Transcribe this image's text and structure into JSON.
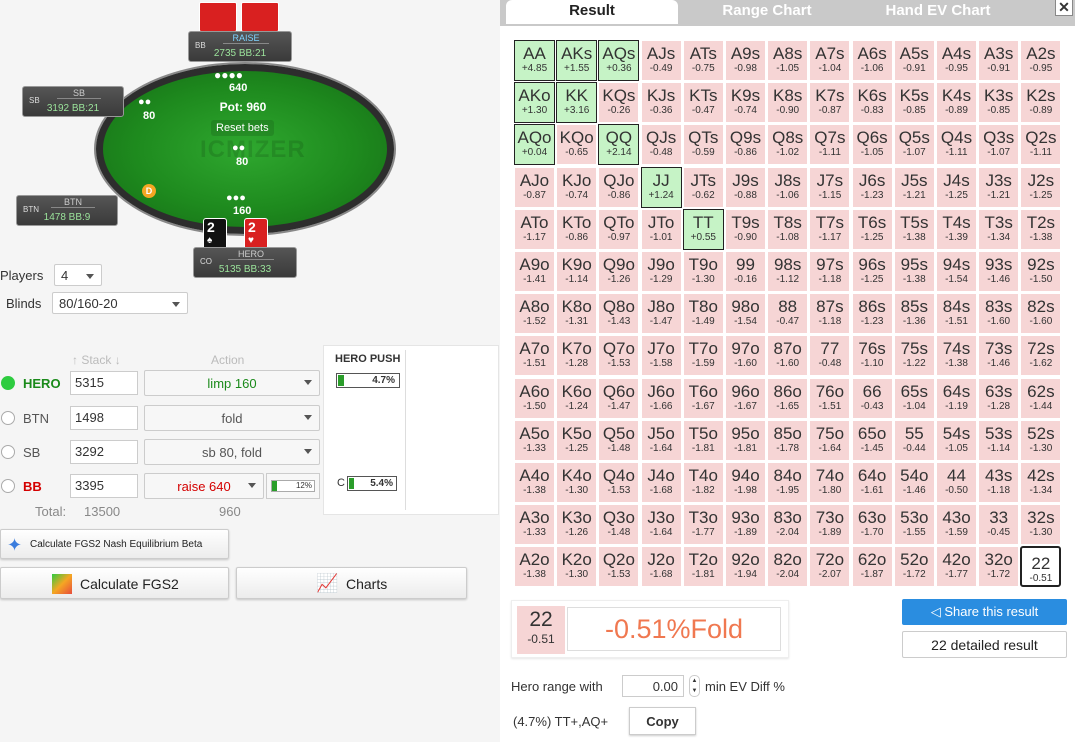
{
  "table": {
    "watermark": "ICMIZER",
    "pot_label": "Pot: 960",
    "reset_label": "Reset bets",
    "dealer": "D",
    "bets": {
      "top": "640",
      "sb": "80",
      "center": "80",
      "hero": "160"
    },
    "seats": {
      "bb": {
        "pos": "BB",
        "name": "RAISE",
        "stack": "2735 BB:21"
      },
      "sb": {
        "pos": "SB",
        "name": "SB",
        "stack": "3192 BB:21"
      },
      "btn": {
        "pos": "BTN",
        "name": "BTN",
        "stack": "1478 BB:9"
      },
      "hero": {
        "pos": "CO",
        "name": "HERO",
        "stack": "5135 BB:33"
      }
    },
    "hero_cards": [
      {
        "rank": "2",
        "suit": "spade"
      },
      {
        "rank": "2",
        "suit": "heart"
      }
    ]
  },
  "settings": {
    "players_label": "Players",
    "players_value": "4",
    "blinds_label": "Blinds",
    "blinds_value": "80/160-20"
  },
  "players_table": {
    "stack_header": "Stack",
    "action_header": "Action",
    "rows": [
      {
        "name": "HERO",
        "stack": "5315",
        "action": "limp 160",
        "color": "#1a8a1a",
        "selected": true
      },
      {
        "name": "BTN",
        "stack": "1498",
        "action": "fold",
        "color": "#555555",
        "selected": false
      },
      {
        "name": "SB",
        "stack": "3292",
        "action": "sb 80, fold",
        "color": "#555555",
        "selected": false
      },
      {
        "name": "BB",
        "stack": "3395",
        "action": "raise 640",
        "color": "#d40000",
        "selected": false,
        "bb_pct": "12%"
      }
    ],
    "total_label": "Total:",
    "total_stack": "13500",
    "total_pot": "960"
  },
  "hero_push": {
    "title": "HERO PUSH",
    "push_pct": "4.7%",
    "push_fill": 0.047,
    "call_label": "C",
    "call_pct": "5.4%",
    "call_fill": 0.054
  },
  "buttons": {
    "nash": "Calculate FGS2 Nash Equilibrium  Beta",
    "calc": "Calculate FGS2",
    "charts": "Charts",
    "share": "Share this result",
    "detail": "22 detailed result",
    "copy": "Copy"
  },
  "tabs": [
    "Result",
    "Range Chart",
    "Hand EV Chart"
  ],
  "grid": [
    [
      [
        "AA",
        "+4.85",
        1
      ],
      [
        "AKs",
        "+1.55",
        1
      ],
      [
        "AQs",
        "+0.36",
        1
      ],
      [
        "AJs",
        "-0.49",
        0
      ],
      [
        "ATs",
        "-0.75",
        0
      ],
      [
        "A9s",
        "-0.98",
        0
      ],
      [
        "A8s",
        "-1.05",
        0
      ],
      [
        "A7s",
        "-1.04",
        0
      ],
      [
        "A6s",
        "-1.06",
        0
      ],
      [
        "A5s",
        "-0.91",
        0
      ],
      [
        "A4s",
        "-0.95",
        0
      ],
      [
        "A3s",
        "-0.91",
        0
      ],
      [
        "A2s",
        "-0.95",
        0
      ]
    ],
    [
      [
        "AKo",
        "+1.30",
        1
      ],
      [
        "KK",
        "+3.16",
        1
      ],
      [
        "KQs",
        "-0.26",
        0
      ],
      [
        "KJs",
        "-0.36",
        0
      ],
      [
        "KTs",
        "-0.47",
        0
      ],
      [
        "K9s",
        "-0.74",
        0
      ],
      [
        "K8s",
        "-0.90",
        0
      ],
      [
        "K7s",
        "-0.87",
        0
      ],
      [
        "K6s",
        "-0.83",
        0
      ],
      [
        "K5s",
        "-0.85",
        0
      ],
      [
        "K4s",
        "-0.89",
        0
      ],
      [
        "K3s",
        "-0.85",
        0
      ],
      [
        "K2s",
        "-0.89",
        0
      ]
    ],
    [
      [
        "AQo",
        "+0.04",
        1
      ],
      [
        "KQo",
        "-0.65",
        0
      ],
      [
        "QQ",
        "+2.14",
        1
      ],
      [
        "QJs",
        "-0.48",
        0
      ],
      [
        "QTs",
        "-0.59",
        0
      ],
      [
        "Q9s",
        "-0.86",
        0
      ],
      [
        "Q8s",
        "-1.02",
        0
      ],
      [
        "Q7s",
        "-1.11",
        0
      ],
      [
        "Q6s",
        "-1.05",
        0
      ],
      [
        "Q5s",
        "-1.07",
        0
      ],
      [
        "Q4s",
        "-1.11",
        0
      ],
      [
        "Q3s",
        "-1.07",
        0
      ],
      [
        "Q2s",
        "-1.11",
        0
      ]
    ],
    [
      [
        "AJo",
        "-0.87",
        0
      ],
      [
        "KJo",
        "-0.74",
        0
      ],
      [
        "QJo",
        "-0.86",
        0
      ],
      [
        "JJ",
        "+1.24",
        1
      ],
      [
        "JTs",
        "-0.62",
        0
      ],
      [
        "J9s",
        "-0.88",
        0
      ],
      [
        "J8s",
        "-1.06",
        0
      ],
      [
        "J7s",
        "-1.15",
        0
      ],
      [
        "J6s",
        "-1.23",
        0
      ],
      [
        "J5s",
        "-1.21",
        0
      ],
      [
        "J4s",
        "-1.25",
        0
      ],
      [
        "J3s",
        "-1.21",
        0
      ],
      [
        "J2s",
        "-1.25",
        0
      ]
    ],
    [
      [
        "ATo",
        "-1.17",
        0
      ],
      [
        "KTo",
        "-0.86",
        0
      ],
      [
        "QTo",
        "-0.97",
        0
      ],
      [
        "JTo",
        "-1.01",
        0
      ],
      [
        "TT",
        "+0.55",
        1
      ],
      [
        "T9s",
        "-0.90",
        0
      ],
      [
        "T8s",
        "-1.08",
        0
      ],
      [
        "T7s",
        "-1.17",
        0
      ],
      [
        "T6s",
        "-1.25",
        0
      ],
      [
        "T5s",
        "-1.38",
        0
      ],
      [
        "T4s",
        "-1.39",
        0
      ],
      [
        "T3s",
        "-1.34",
        0
      ],
      [
        "T2s",
        "-1.38",
        0
      ]
    ],
    [
      [
        "A9o",
        "-1.41",
        0
      ],
      [
        "K9o",
        "-1.14",
        0
      ],
      [
        "Q9o",
        "-1.26",
        0
      ],
      [
        "J9o",
        "-1.29",
        0
      ],
      [
        "T9o",
        "-1.30",
        0
      ],
      [
        "99",
        "-0.16",
        0
      ],
      [
        "98s",
        "-1.12",
        0
      ],
      [
        "97s",
        "-1.18",
        0
      ],
      [
        "96s",
        "-1.25",
        0
      ],
      [
        "95s",
        "-1.38",
        0
      ],
      [
        "94s",
        "-1.54",
        0
      ],
      [
        "93s",
        "-1.46",
        0
      ],
      [
        "92s",
        "-1.50",
        0
      ]
    ],
    [
      [
        "A8o",
        "-1.52",
        0
      ],
      [
        "K8o",
        "-1.31",
        0
      ],
      [
        "Q8o",
        "-1.43",
        0
      ],
      [
        "J8o",
        "-1.47",
        0
      ],
      [
        "T8o",
        "-1.49",
        0
      ],
      [
        "98o",
        "-1.54",
        0
      ],
      [
        "88",
        "-0.47",
        0
      ],
      [
        "87s",
        "-1.18",
        0
      ],
      [
        "86s",
        "-1.23",
        0
      ],
      [
        "85s",
        "-1.36",
        0
      ],
      [
        "84s",
        "-1.51",
        0
      ],
      [
        "83s",
        "-1.60",
        0
      ],
      [
        "82s",
        "-1.60",
        0
      ]
    ],
    [
      [
        "A7o",
        "-1.51",
        0
      ],
      [
        "K7o",
        "-1.28",
        0
      ],
      [
        "Q7o",
        "-1.53",
        0
      ],
      [
        "J7o",
        "-1.58",
        0
      ],
      [
        "T7o",
        "-1.59",
        0
      ],
      [
        "97o",
        "-1.60",
        0
      ],
      [
        "87o",
        "-1.60",
        0
      ],
      [
        "77",
        "-0.48",
        0
      ],
      [
        "76s",
        "-1.10",
        0
      ],
      [
        "75s",
        "-1.22",
        0
      ],
      [
        "74s",
        "-1.38",
        0
      ],
      [
        "73s",
        "-1.46",
        0
      ],
      [
        "72s",
        "-1.62",
        0
      ]
    ],
    [
      [
        "A6o",
        "-1.50",
        0
      ],
      [
        "K6o",
        "-1.24",
        0
      ],
      [
        "Q6o",
        "-1.47",
        0
      ],
      [
        "J6o",
        "-1.66",
        0
      ],
      [
        "T6o",
        "-1.67",
        0
      ],
      [
        "96o",
        "-1.67",
        0
      ],
      [
        "86o",
        "-1.65",
        0
      ],
      [
        "76o",
        "-1.51",
        0
      ],
      [
        "66",
        "-0.43",
        0
      ],
      [
        "65s",
        "-1.04",
        0
      ],
      [
        "64s",
        "-1.19",
        0
      ],
      [
        "63s",
        "-1.28",
        0
      ],
      [
        "62s",
        "-1.44",
        0
      ]
    ],
    [
      [
        "A5o",
        "-1.33",
        0
      ],
      [
        "K5o",
        "-1.25",
        0
      ],
      [
        "Q5o",
        "-1.48",
        0
      ],
      [
        "J5o",
        "-1.64",
        0
      ],
      [
        "T5o",
        "-1.81",
        0
      ],
      [
        "95o",
        "-1.81",
        0
      ],
      [
        "85o",
        "-1.78",
        0
      ],
      [
        "75o",
        "-1.64",
        0
      ],
      [
        "65o",
        "-1.45",
        0
      ],
      [
        "55",
        "-0.44",
        0
      ],
      [
        "54s",
        "-1.05",
        0
      ],
      [
        "53s",
        "-1.14",
        0
      ],
      [
        "52s",
        "-1.30",
        0
      ]
    ],
    [
      [
        "A4o",
        "-1.38",
        0
      ],
      [
        "K4o",
        "-1.30",
        0
      ],
      [
        "Q4o",
        "-1.53",
        0
      ],
      [
        "J4o",
        "-1.68",
        0
      ],
      [
        "T4o",
        "-1.82",
        0
      ],
      [
        "94o",
        "-1.98",
        0
      ],
      [
        "84o",
        "-1.95",
        0
      ],
      [
        "74o",
        "-1.80",
        0
      ],
      [
        "64o",
        "-1.61",
        0
      ],
      [
        "54o",
        "-1.46",
        0
      ],
      [
        "44",
        "-0.50",
        0
      ],
      [
        "43s",
        "-1.18",
        0
      ],
      [
        "42s",
        "-1.34",
        0
      ]
    ],
    [
      [
        "A3o",
        "-1.33",
        0
      ],
      [
        "K3o",
        "-1.26",
        0
      ],
      [
        "Q3o",
        "-1.48",
        0
      ],
      [
        "J3o",
        "-1.64",
        0
      ],
      [
        "T3o",
        "-1.77",
        0
      ],
      [
        "93o",
        "-1.89",
        0
      ],
      [
        "83o",
        "-2.04",
        0
      ],
      [
        "73o",
        "-1.89",
        0
      ],
      [
        "63o",
        "-1.70",
        0
      ],
      [
        "53o",
        "-1.55",
        0
      ],
      [
        "43o",
        "-1.59",
        0
      ],
      [
        "33",
        "-0.45",
        0
      ],
      [
        "32s",
        "-1.30",
        0
      ]
    ],
    [
      [
        "A2o",
        "-1.38",
        0
      ],
      [
        "K2o",
        "-1.30",
        0
      ],
      [
        "Q2o",
        "-1.53",
        0
      ],
      [
        "J2o",
        "-1.68",
        0
      ],
      [
        "T2o",
        "-1.81",
        0
      ],
      [
        "92o",
        "-1.94",
        0
      ],
      [
        "82o",
        "-2.04",
        0
      ],
      [
        "72o",
        "-2.07",
        0
      ],
      [
        "62o",
        "-1.87",
        0
      ],
      [
        "52o",
        "-1.72",
        0
      ],
      [
        "42o",
        "-1.77",
        0
      ],
      [
        "32o",
        "-1.72",
        0
      ],
      [
        "22",
        "-0.51",
        2
      ]
    ]
  ],
  "detail": {
    "hand": "22",
    "ev": "-0.51",
    "result": "-0.51%Fold"
  },
  "range": {
    "label": "Hero range with",
    "value": "0.00",
    "suffix": "min EV Diff %",
    "summary": "(4.7%) TT+,AQ+"
  }
}
